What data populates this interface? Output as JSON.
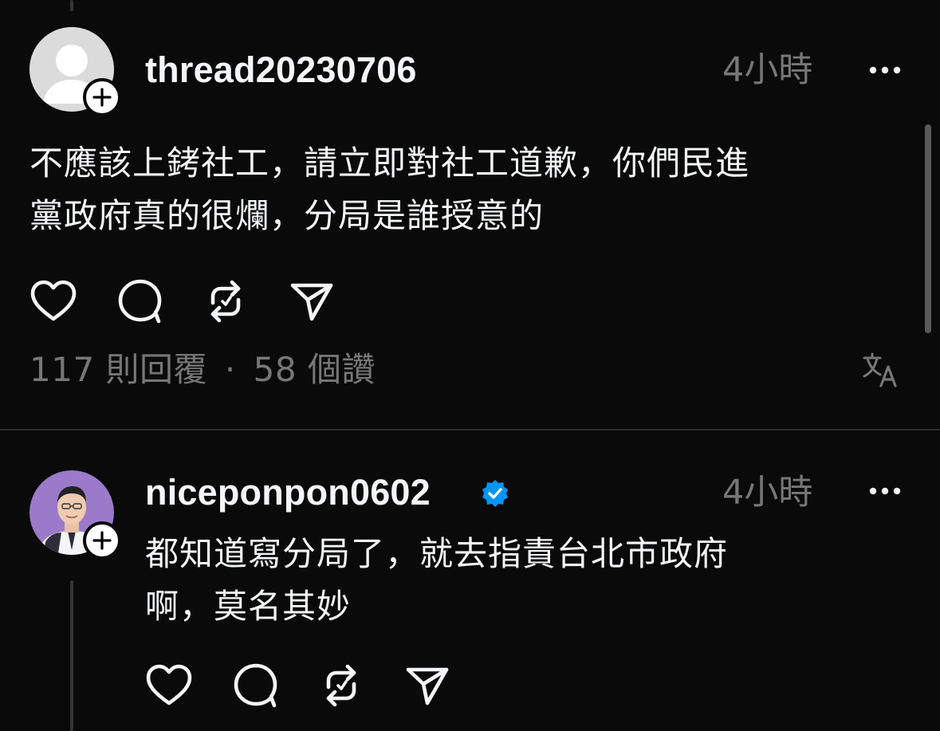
{
  "posts": [
    {
      "username": "thread20230706",
      "verified": false,
      "time": "4小時",
      "text_lines": [
        "不應該上銬社工，請立即對社工道歉，你們民進",
        "黨政府真的很爛，分局是誰授意的"
      ],
      "stats": {
        "replies": "117 則回覆",
        "separator": "·",
        "likes": "58 個讚"
      }
    },
    {
      "username": "niceponpon0602",
      "verified": true,
      "time": "4小時",
      "text_lines": [
        "都知道寫分局了，就去指責台北市政府",
        "啊，莫名其妙"
      ]
    }
  ],
  "icons": {
    "more": "more-horizontal-icon",
    "like": "heart-icon",
    "comment": "comment-bubble-icon",
    "repost": "repost-icon",
    "share": "send-icon",
    "translate": "translate-icon",
    "follow": "plus-icon",
    "verified": "verified-badge-icon"
  },
  "colors": {
    "background": "#0a0a0a",
    "text": "#f3f5f7",
    "muted": "#777777",
    "verified": "#0095f6"
  }
}
